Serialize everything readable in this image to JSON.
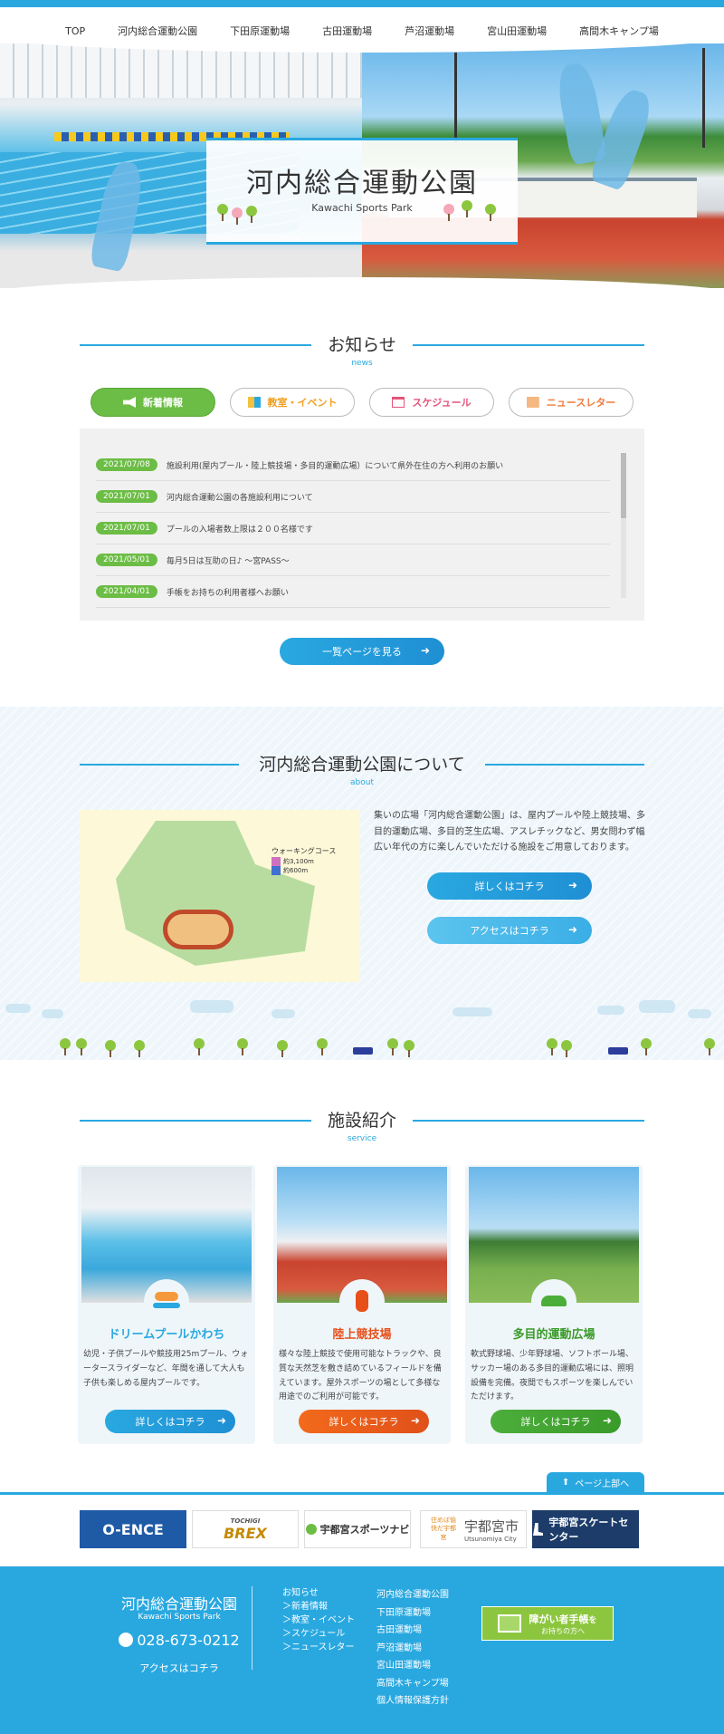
{
  "nav": [
    "TOP",
    "河内総合運動公園",
    "下田原運動場",
    "古田運動場",
    "芦沼運動場",
    "宮山田運動場",
    "高間木キャンプ場"
  ],
  "hero": {
    "title": "河内総合運動公園",
    "subtitle": "Kawachi Sports Park"
  },
  "news": {
    "title": "お知らせ",
    "title_en": "news",
    "tabs": [
      "新着情報",
      "教室・イベント",
      "スケジュール",
      "ニュースレター"
    ],
    "items": [
      {
        "date": "2021/07/08",
        "text": "施設利用(屋内プール・陸上競技場・多目的運動広場）について県外在住の方へ利用のお願い"
      },
      {
        "date": "2021/07/01",
        "text": "河内総合運動公園の各施設利用について"
      },
      {
        "date": "2021/07/01",
        "text": "プールの入場者数上限は２００名様です"
      },
      {
        "date": "2021/05/01",
        "text": "毎月5日は互助の日♪ ～宮PASS～"
      },
      {
        "date": "2021/04/01",
        "text": "手帳をお持ちの利用者様へお願い"
      }
    ],
    "more": "一覧ページを見る"
  },
  "about": {
    "title": "河内総合運動公園について",
    "title_en": "about",
    "text": "集いの広場「河内総合運動公園」は、屋内プールや陸上競技場、多目的運動広場、多目的芝生広場、アスレチックなど、男女問わず幅広い年代の方に楽しんでいただける施設をご用意しております。",
    "btn_detail": "詳しくはコチラ",
    "btn_access": "アクセスはコチラ",
    "map": {
      "legend_title": "ウォーキングコース",
      "legend_1": "約3,100m",
      "legend_2": "約600m"
    }
  },
  "service": {
    "title": "施設紹介",
    "title_en": "service",
    "cards": [
      {
        "name": "ドリームプールかわち",
        "text": "幼児・子供プールや競技用25mプール、ウォータースライダーなど、年間を通して大人も子供も楽しめる屋内プールです。",
        "btn": "詳しくはコチラ",
        "color": "#29a8e0"
      },
      {
        "name": "陸上競技場",
        "text": "様々な陸上競技で使用可能なトラックや、良質な天然芝を敷き詰めているフィールドを備えています。屋外スポーツの場として多様な用途でのご利用が可能です。",
        "btn": "詳しくはコチラ",
        "color": "#e8501a"
      },
      {
        "name": "多目的運動広場",
        "text": "軟式野球場、少年野球場、ソフトボール場、サッカー場のある多目的運動広場には、照明設備を完備。夜間でもスポーツを楽しんでいただけます。",
        "btn": "詳しくはコチラ",
        "color": "#3a9a2a"
      }
    ]
  },
  "pagetop": "ページ上部へ",
  "banners": [
    "O-ENCE",
    "BREX",
    "宇都宮スポーツナビ",
    "宇都宮市",
    "宇都宮スケートセンター"
  ],
  "banner_sub": {
    "brex_top": "TOCHIGI",
    "city_en": "Utsunomiya City",
    "city_side": "住めば愉快だ宇都宮"
  },
  "footer": {
    "name": "河内総合運動公園",
    "name_en": "Kawachi Sports Park",
    "tel": "028-673-0212",
    "access": "アクセスはコチラ",
    "col1": [
      "お知らせ",
      "＞新着情報",
      "＞教室・イベント",
      "＞スケジュール",
      "＞ニュースレター"
    ],
    "col2": [
      "河内総合運動公園",
      "下田原運動場",
      "古田運動場",
      "芦沼運動場",
      "宮山田運動場",
      "高間木キャンプ場",
      "個人情報保護方針"
    ],
    "shogai_1": "障がい者手帳",
    "shogai_2": "を",
    "shogai_3": "お持ちの方へ"
  }
}
